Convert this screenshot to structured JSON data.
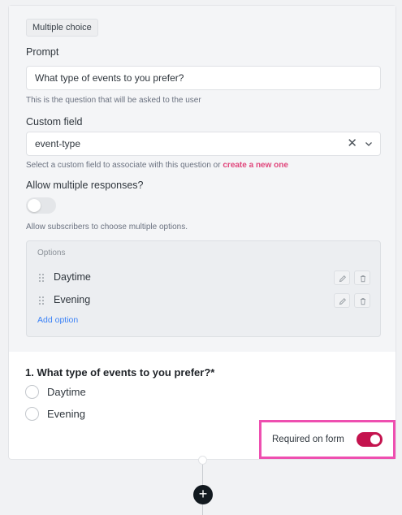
{
  "editor": {
    "type_badge": "Multiple choice",
    "prompt_label": "Prompt",
    "prompt_value": "What type of events to you prefer?",
    "prompt_hint": "This is the question that will be asked to the user",
    "custom_field_label": "Custom field",
    "custom_field_value": "event-type",
    "custom_field_hint": "Select a custom field to associate with this question or",
    "custom_field_link": "create a new one",
    "allow_multiple_label": "Allow multiple responses?",
    "allow_multiple_enabled": false,
    "allow_multiple_hint": "Allow subscribers to choose multiple options.",
    "options_title": "Options",
    "options": [
      {
        "label": "Daytime"
      },
      {
        "label": "Evening"
      }
    ],
    "add_option_label": "Add option"
  },
  "preview": {
    "question": "1.  What type of events to you prefer?*",
    "choices": [
      {
        "label": "Daytime"
      },
      {
        "label": "Evening"
      }
    ]
  },
  "required": {
    "label": "Required on form",
    "enabled": true
  },
  "icons": {
    "clear": "close-icon",
    "dropdown": "chevron-down-icon",
    "drag": "drag-handle-icon",
    "edit": "pencil-icon",
    "delete": "trash-icon",
    "add": "plus-icon"
  },
  "colors": {
    "accent_pink": "#e0457b",
    "toggle_on": "#c4134e",
    "highlight_border": "#ee4fb0",
    "link_blue": "#3b82f6"
  }
}
